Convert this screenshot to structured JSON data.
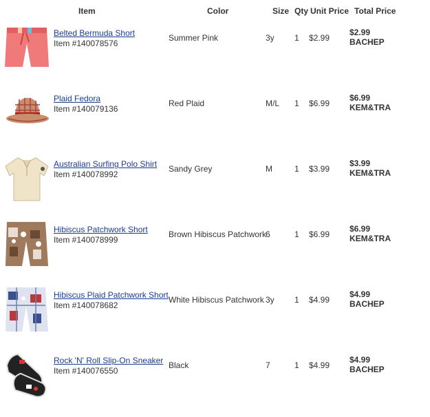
{
  "headers": {
    "item": "Item",
    "color": "Color",
    "size": "Size",
    "qty": "Qty",
    "unit_price": "Unit Price",
    "total_price": "Total Price"
  },
  "rows": [
    {
      "name": "Belted Bermuda Short",
      "item_no": "Item #140078576",
      "color": "Summer Pink",
      "size": "3y",
      "qty": "1",
      "unit_price": "$2.99",
      "total": "$2.99",
      "code": "BACHEP",
      "image": "pink-shorts-icon"
    },
    {
      "name": "Plaid Fedora",
      "item_no": "Item #140079136",
      "color": "Red Plaid",
      "size": "M/L",
      "qty": "1",
      "unit_price": "$6.99",
      "total": "$6.99",
      "code": "KEM&TRA",
      "image": "plaid-fedora-icon"
    },
    {
      "name": "Australian Surfing Polo Shirt",
      "item_no": "Item #140078992",
      "color": "Sandy Grey",
      "size": "M",
      "qty": "1",
      "unit_price": "$3.99",
      "total": "$3.99",
      "code": "KEM&TRA",
      "image": "polo-shirt-icon"
    },
    {
      "name": "Hibiscus Patchwork Short",
      "item_no": "Item #140078999",
      "color": "Brown Hibiscus Patchwork",
      "size": "6",
      "qty": "1",
      "unit_price": "$6.99",
      "total": "$6.99",
      "code": "KEM&TRA",
      "image": "brown-patchwork-shorts-icon"
    },
    {
      "name": "Hibiscus Plaid Patchwork Short",
      "item_no": "Item #140078682",
      "color": "White Hibiscus Patchwork",
      "size": "3y",
      "qty": "1",
      "unit_price": "$4.99",
      "total": "$4.99",
      "code": "BACHEP",
      "image": "plaid-patchwork-shorts-icon"
    },
    {
      "name": "Rock 'N' Roll Slip-On Sneaker",
      "item_no": "Item #140076550",
      "color": "Black",
      "size": "7",
      "qty": "1",
      "unit_price": "$4.99",
      "total": "$4.99",
      "code": "BACHEP",
      "image": "sneaker-icon"
    }
  ]
}
